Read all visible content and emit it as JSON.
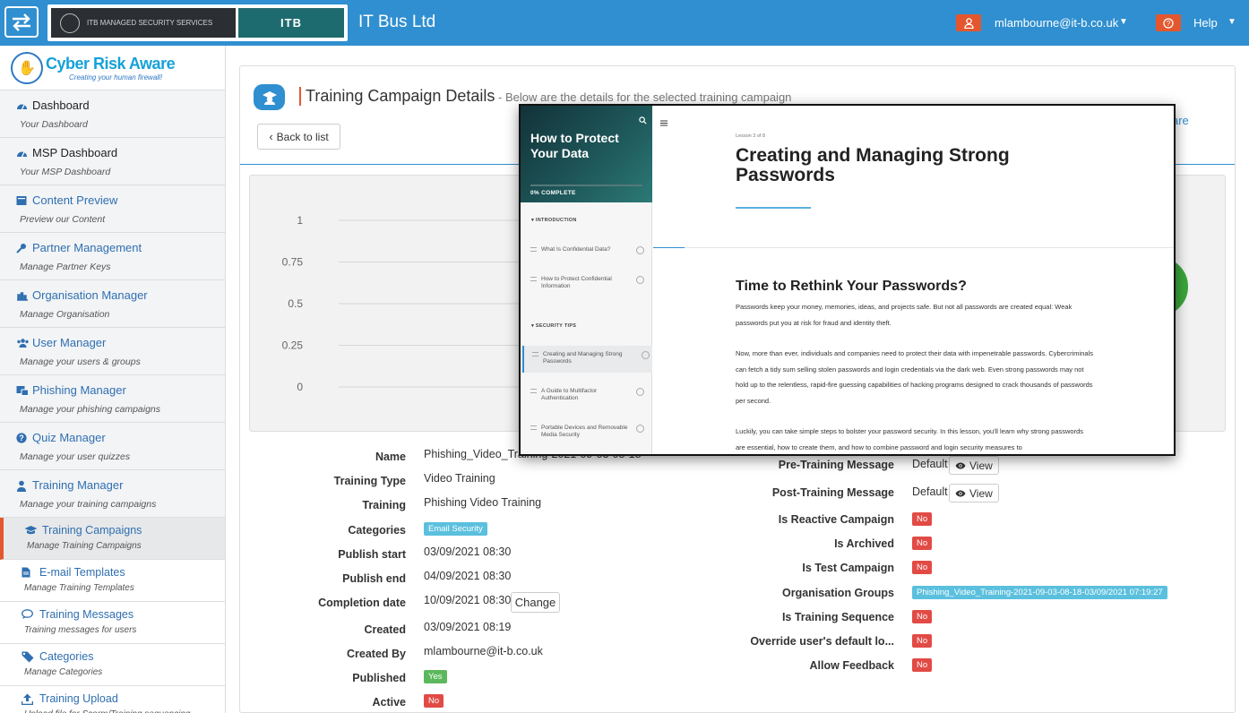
{
  "topbar": {
    "logo_left_text": "ITB MANAGED SECURITY SERVICES",
    "logo_right_text": "ITB",
    "company": "IT Bus Ltd",
    "user_email": "mlambourne@it-b.co.uk",
    "help": "Help",
    "accent": "#2f8fd0",
    "button_color": "#e4572e"
  },
  "sidebar": {
    "brand_title_a": "Cyber ",
    "brand_title_b": "Risk Aware",
    "brand_tagline": "Creating your human firewall!",
    "items": [
      {
        "label": "Dashboard",
        "sub": "Your Dashboard",
        "icon": "gauge-icon"
      },
      {
        "label": "MSP Dashboard",
        "sub": "Your MSP Dashboard",
        "icon": "gauge-icon"
      },
      {
        "label": "Content Preview",
        "sub": "Preview our Content",
        "icon": "preview-icon"
      },
      {
        "label": "Partner Management",
        "sub": "Manage Partner Keys",
        "icon": "key-icon"
      },
      {
        "label": "Organisation Manager",
        "sub": "Manage Organisation",
        "icon": "chart-icon"
      },
      {
        "label": "User Manager",
        "sub": "Manage your users & groups",
        "icon": "users-icon"
      },
      {
        "label": "Phishing Manager",
        "sub": "Manage your phishing campaigns",
        "icon": "phishing-icon"
      },
      {
        "label": "Quiz Manager",
        "sub": "Manage your user quizzes",
        "icon": "question-icon"
      },
      {
        "label": "Training Manager",
        "sub": "Manage your training campaigns",
        "icon": "teacher-icon"
      }
    ],
    "subitems": [
      {
        "label": "Training Campaigns",
        "sub": "Manage Training Campaigns",
        "icon": "graduation-icon"
      },
      {
        "label": "E-mail Templates",
        "sub": "Manage Training Templates",
        "icon": "file-icon"
      },
      {
        "label": "Training Messages",
        "sub": "Training messages for users",
        "icon": "comment-icon"
      },
      {
        "label": "Categories",
        "sub": "Manage Categories",
        "icon": "tags-icon"
      },
      {
        "label": "Training Upload",
        "sub": "Upload file for Scorm/Training sequencing",
        "icon": "upload-icon"
      }
    ]
  },
  "page": {
    "title": "Training Campaign Details",
    "subtitle": " - Below are the details for the selected training campaign",
    "back": "Back to list",
    "share_fragment": "are"
  },
  "chart_data": {
    "type": "bar",
    "yticks": [
      "1",
      "0.75",
      "0.5",
      "0.25",
      "0"
    ],
    "ylim": [
      0,
      1
    ],
    "title": "",
    "xlabel": "",
    "ylabel": ""
  },
  "details_left": [
    {
      "label": "Name",
      "value": "Phishing_Video_Training-2021-09-03-08-18"
    },
    {
      "label": "Training Type",
      "value": "Video Training"
    },
    {
      "label": "Training",
      "value": "Phishing Video Training"
    },
    {
      "label": "Categories",
      "badge": "Email Security"
    },
    {
      "label": "Publish start",
      "value": "03/09/2021 08:30"
    },
    {
      "label": "Publish end",
      "value": "04/09/2021 08:30"
    },
    {
      "label": "Completion date",
      "value": "10/09/2021 08:30",
      "button": "Change"
    },
    {
      "label": "Created",
      "value": "03/09/2021 08:19"
    },
    {
      "label": "Created By",
      "value": "mlambourne@it-b.co.uk"
    },
    {
      "label": "Published",
      "badge": "Yes"
    },
    {
      "label": "Active",
      "badge": "No"
    }
  ],
  "details_right": [
    {
      "label": "Pre-Training Message",
      "value": "Default",
      "button": "View"
    },
    {
      "label": "Post-Training Message",
      "value": "Default",
      "button": "View"
    },
    {
      "label": "Is Reactive Campaign",
      "badge": "No"
    },
    {
      "label": "Is Archived",
      "badge": "No"
    },
    {
      "label": "Is Test Campaign",
      "badge": "No"
    },
    {
      "label": "Organisation Groups",
      "badge": "Phishing_Video_Training-2021-09-03-08-18-03/09/2021 07:19:27"
    },
    {
      "label": "Is Training Sequence",
      "badge": "No"
    },
    {
      "label": "Override user's default lo...",
      "badge": "No"
    },
    {
      "label": "Allow Feedback",
      "badge": "No"
    }
  ],
  "course_popup": {
    "course_title": "How to Protect Your Data",
    "progress": "0% COMPLETE",
    "progress_fraction": 0,
    "section1": "INTRODUCTION",
    "lessons1": [
      "What Is Confidential Data?",
      "How to Protect Confidential Information"
    ],
    "section2": "SECURITY TIPS",
    "lessons2": [
      "Creating and Managing Strong Passwords",
      "A Guide to Multifactor Authentication",
      "Portable Devices and Removable Media Security"
    ],
    "lesson_label": "Lesson 3 of 8",
    "lesson_title": "Creating and Managing Strong Passwords",
    "heading": "Time to Rethink Your Passwords?",
    "para1": "Passwords keep your money, memories, ideas, and projects safe. But not all passwords are created equal: Weak passwords put you at risk for fraud and identity theft.",
    "para2": "Now, more than ever, individuals and companies need to protect their data with impenetrable passwords. Cybercriminals can fetch a tidy sum selling stolen passwords and login credentials via the dark web. Even strong passwords may not hold up to the relentless, rapid-fire guessing capabilities of hacking programs designed to crack thousands of passwords per second.",
    "para3": "Luckily, you can take simple steps to bolster your password security. In this lesson, you'll learn why strong passwords are essential, how to create them, and how to combine password and login security measures to"
  }
}
